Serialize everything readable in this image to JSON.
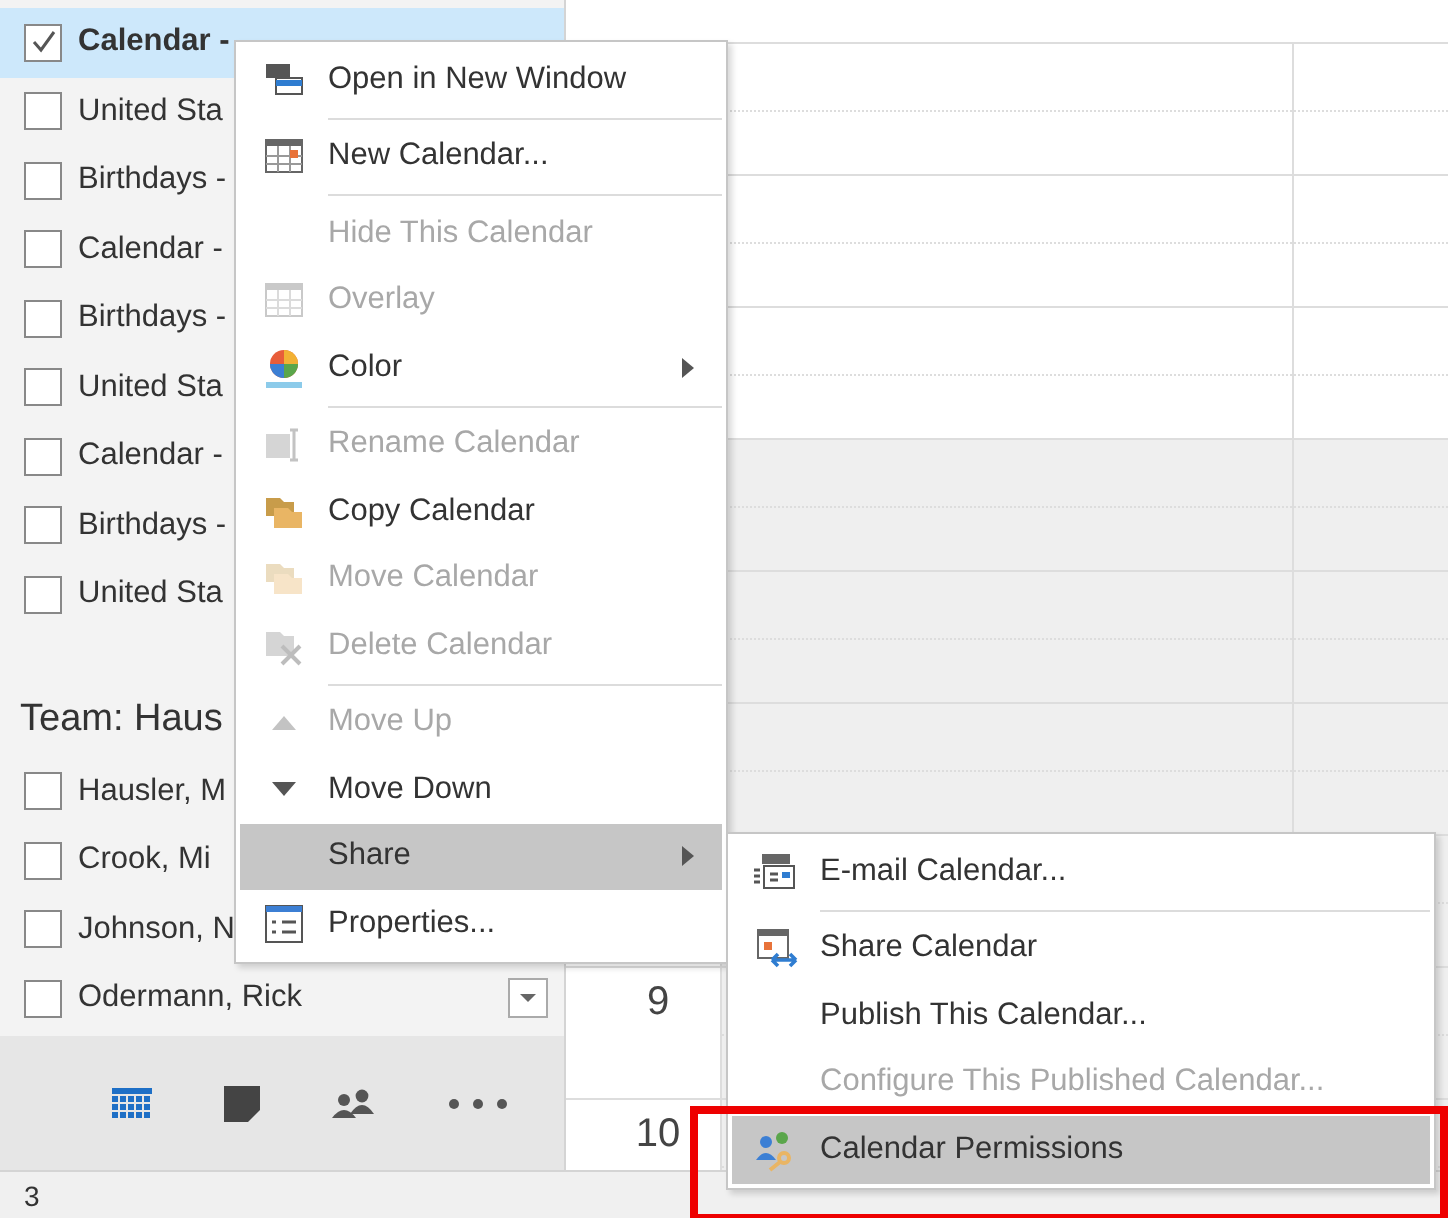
{
  "calendar_list": {
    "items": [
      {
        "label": "Calendar -",
        "checked": true,
        "selected": true
      },
      {
        "label": "United Sta",
        "checked": false,
        "selected": false
      },
      {
        "label": "Birthdays -",
        "checked": false,
        "selected": false
      },
      {
        "label": "Calendar -",
        "checked": false,
        "selected": false
      },
      {
        "label": "Birthdays -",
        "checked": false,
        "selected": false
      },
      {
        "label": "United Sta",
        "checked": false,
        "selected": false
      },
      {
        "label": "Calendar -",
        "checked": false,
        "selected": false
      },
      {
        "label": "Birthdays -",
        "checked": false,
        "selected": false
      },
      {
        "label": "United Sta",
        "checked": false,
        "selected": false
      }
    ]
  },
  "team_group": {
    "title": "Team: Haus",
    "items": [
      {
        "label": "Hausler, M",
        "checked": false,
        "selected": false
      },
      {
        "label": "Crook, Mi",
        "checked": false,
        "selected": false
      },
      {
        "label": "Johnson, N",
        "checked": false,
        "selected": false
      },
      {
        "label": "Odermann, Rick",
        "checked": false,
        "selected": false
      }
    ]
  },
  "nav_bar": [
    {
      "kind": "calendar",
      "selected": true
    },
    {
      "kind": "notes",
      "selected": false
    },
    {
      "kind": "people",
      "selected": false
    },
    {
      "kind": "more",
      "selected": false
    }
  ],
  "status_bar": {
    "text": "3"
  },
  "hour_labels": [
    "9",
    "10"
  ],
  "context_menu": {
    "items": [
      {
        "kind": "window",
        "label": "Open in New Window",
        "disabled": false,
        "selected": false,
        "has_submenu": false
      },
      {
        "kind": "separator"
      },
      {
        "kind": "calendar",
        "label": "New Calendar...",
        "disabled": false,
        "selected": false,
        "has_submenu": false
      },
      {
        "kind": "separator"
      },
      {
        "kind": "plain",
        "label": "Hide This Calendar",
        "disabled": true,
        "selected": false,
        "has_submenu": false
      },
      {
        "kind": "overlay",
        "label": "Overlay",
        "disabled": true,
        "selected": false,
        "has_submenu": false
      },
      {
        "kind": "palette",
        "label": "Color",
        "disabled": false,
        "selected": false,
        "has_submenu": true
      },
      {
        "kind": "separator"
      },
      {
        "kind": "rename",
        "label": "Rename Calendar",
        "disabled": true,
        "selected": false,
        "has_submenu": false
      },
      {
        "kind": "folder",
        "label": "Copy Calendar",
        "disabled": false,
        "selected": false,
        "has_submenu": false
      },
      {
        "kind": "folder",
        "label": "Move Calendar",
        "disabled": true,
        "selected": false,
        "has_submenu": false
      },
      {
        "kind": "delete",
        "label": "Delete Calendar",
        "disabled": true,
        "selected": false,
        "has_submenu": false
      },
      {
        "kind": "separator"
      },
      {
        "kind": "up",
        "label": "Move Up",
        "disabled": true,
        "selected": false,
        "has_submenu": false
      },
      {
        "kind": "down",
        "label": "Move Down",
        "disabled": false,
        "selected": false,
        "has_submenu": false
      },
      {
        "kind": "plain",
        "label": "Share",
        "disabled": false,
        "selected": true,
        "has_submenu": true
      },
      {
        "kind": "properties",
        "label": "Properties...",
        "disabled": false,
        "selected": false,
        "has_submenu": false
      }
    ]
  },
  "share_submenu": {
    "items": [
      {
        "kind": "email",
        "label": "E-mail Calendar...",
        "disabled": false,
        "selected": false
      },
      {
        "kind": "separator"
      },
      {
        "kind": "share",
        "label": "Share Calendar",
        "disabled": false,
        "selected": false
      },
      {
        "kind": "plain",
        "label": "Publish This Calendar...",
        "disabled": false,
        "selected": false
      },
      {
        "kind": "plain",
        "label": "Configure This Published Calendar...",
        "disabled": true,
        "selected": false
      },
      {
        "kind": "permissions",
        "label": "Calendar Permissions",
        "disabled": false,
        "selected": true
      }
    ]
  },
  "highlight_frame": {
    "shown": true
  }
}
